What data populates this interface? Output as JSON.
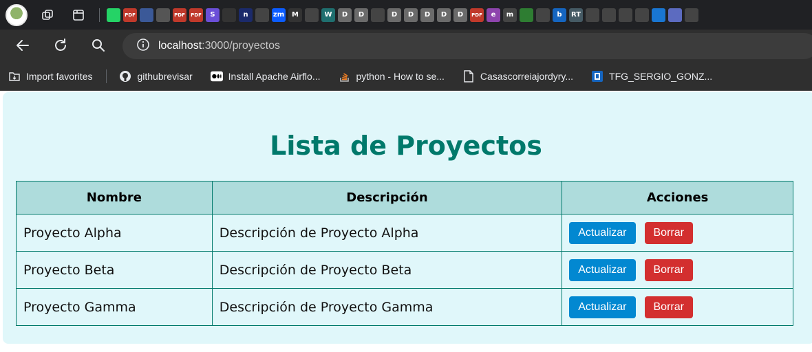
{
  "browser": {
    "url_host": "localhost",
    "url_path": ":3000/proyectos",
    "mini_tabs": [
      {
        "label": "",
        "color": "#25d366"
      },
      {
        "label": "PDF",
        "color": "#c0392b"
      },
      {
        "label": "",
        "color": "#3b5998"
      },
      {
        "label": "",
        "color": "#555555"
      },
      {
        "label": "PDF",
        "color": "#c0392b"
      },
      {
        "label": "PDF",
        "color": "#c0392b"
      },
      {
        "label": "S",
        "color": "#6b4fd8"
      },
      {
        "label": "",
        "color": "#333333"
      },
      {
        "label": "n",
        "color": "#1b2a6b"
      },
      {
        "label": "",
        "color": "#444444"
      },
      {
        "label": "zm",
        "color": "#0b5cff"
      },
      {
        "label": "M",
        "color": "#333333"
      },
      {
        "label": "",
        "color": "#444444"
      },
      {
        "label": "W",
        "color": "#1f6f6f"
      },
      {
        "label": "D",
        "color": "#6b6b6b"
      },
      {
        "label": "D",
        "color": "#6b6b6b"
      },
      {
        "label": "",
        "color": "#444444"
      },
      {
        "label": "D",
        "color": "#6b6b6b"
      },
      {
        "label": "D",
        "color": "#6b6b6b"
      },
      {
        "label": "D",
        "color": "#6b6b6b"
      },
      {
        "label": "D",
        "color": "#6b6b6b"
      },
      {
        "label": "D",
        "color": "#6b6b6b"
      },
      {
        "label": "PDF",
        "color": "#c0392b"
      },
      {
        "label": "e",
        "color": "#8e44ad"
      },
      {
        "label": "m",
        "color": "#444444"
      },
      {
        "label": "",
        "color": "#2e7d32"
      },
      {
        "label": "",
        "color": "#444444"
      },
      {
        "label": "b",
        "color": "#1565c0"
      },
      {
        "label": "RT",
        "color": "#455a64"
      },
      {
        "label": "",
        "color": "#444444"
      },
      {
        "label": "",
        "color": "#444444"
      },
      {
        "label": "",
        "color": "#444444"
      },
      {
        "label": "",
        "color": "#444444"
      },
      {
        "label": "",
        "color": "#1976d2"
      },
      {
        "label": "",
        "color": "#5c6bc0"
      },
      {
        "label": "",
        "color": "#444444"
      }
    ],
    "bookmarks": [
      {
        "label": "Import favorites",
        "icon": "import-icon"
      },
      {
        "label": "githubrevisar",
        "icon": "github-icon"
      },
      {
        "label": "Install Apache Airflo...",
        "icon": "medium-icon"
      },
      {
        "label": "python - How to se...",
        "icon": "stackoverflow-icon"
      },
      {
        "label": "Casascorreiajordyry...",
        "icon": "document-icon"
      },
      {
        "label": "TFG_SERGIO_GONZ...",
        "icon": "docs-icon"
      }
    ]
  },
  "page": {
    "title": "Lista de Proyectos",
    "columns": [
      "Nombre",
      "Descripción",
      "Acciones"
    ],
    "rows": [
      {
        "name": "Proyecto Alpha",
        "description": "Descripción de Proyecto Alpha"
      },
      {
        "name": "Proyecto Beta",
        "description": "Descripción de Proyecto Beta"
      },
      {
        "name": "Proyecto Gamma",
        "description": "Descripción de Proyecto Gamma"
      }
    ],
    "update_label": "Actualizar",
    "delete_label": "Borrar"
  },
  "colors": {
    "accent": "#00796b",
    "background": "#e0f7fa",
    "header_bg": "#aedcdc",
    "update_button": "#0288d1",
    "delete_button": "#d32f2f"
  }
}
